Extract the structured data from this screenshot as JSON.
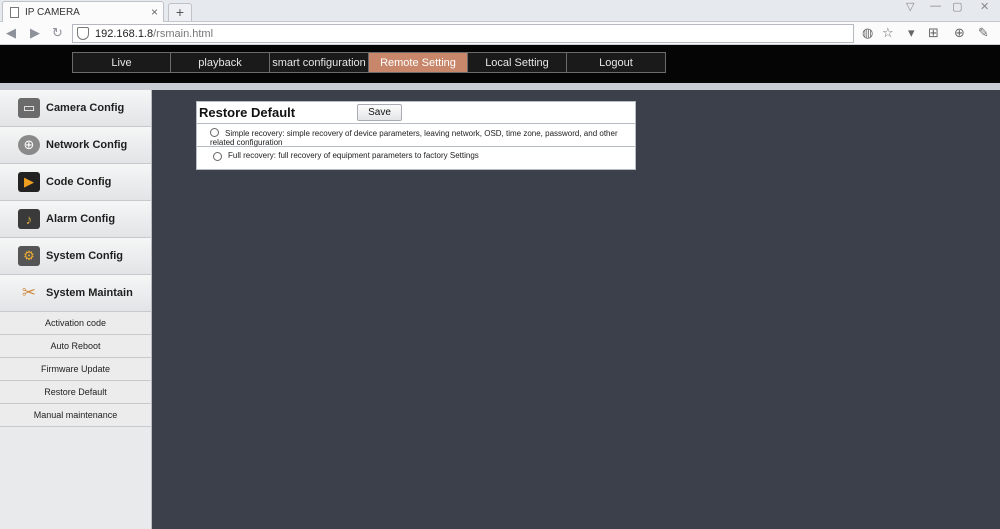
{
  "browser": {
    "tab_title": "IP CAMERA",
    "tab_close": "×",
    "new_tab": "+",
    "url_host": "192.168.1.8",
    "url_path": "/rsmain.html"
  },
  "menu": [
    {
      "label": "Live"
    },
    {
      "label": "playback"
    },
    {
      "label": "smart configuration"
    },
    {
      "label": "Remote Setting"
    },
    {
      "label": "Local Setting"
    },
    {
      "label": "Logout"
    }
  ],
  "active_menu": "Remote Setting",
  "sidebar": {
    "main_items": [
      {
        "label": "Camera Config",
        "icon": "monitor-icon"
      },
      {
        "label": "Network Config",
        "icon": "globe-icon"
      },
      {
        "label": "Code Config",
        "icon": "video-icon"
      },
      {
        "label": "Alarm Config",
        "icon": "alarm-icon"
      },
      {
        "label": "System Config",
        "icon": "gear-icon"
      },
      {
        "label": "System Maintain",
        "icon": "tools-icon"
      }
    ],
    "sub_items": [
      {
        "label": "Activation code"
      },
      {
        "label": "Auto Reboot"
      },
      {
        "label": "Firmware Update"
      },
      {
        "label": "Restore Default"
      },
      {
        "label": "Manual maintenance"
      }
    ]
  },
  "panel": {
    "title": "Restore Default",
    "save_label": "Save",
    "option1": "Simple recovery: simple recovery of device parameters, leaving network, OSD, time zone, password, and other related configuration",
    "option2": "Full recovery: full recovery of equipment parameters to factory Settings"
  },
  "colors": {
    "active_menu": "#c8876a",
    "content_bg": "#3c404b",
    "header_bg": "#050505"
  }
}
